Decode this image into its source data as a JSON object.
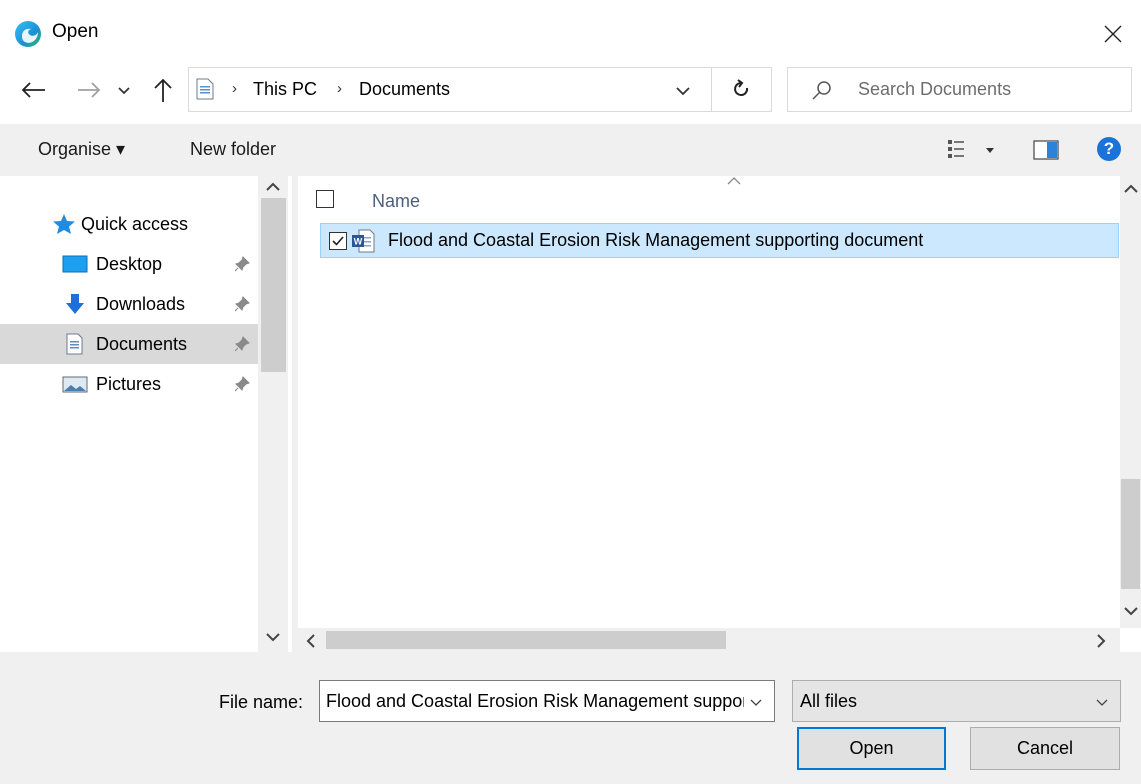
{
  "window": {
    "title": "Open",
    "icons": {
      "app": "edge-icon",
      "close": "close-icon"
    }
  },
  "address": {
    "crumbs": [
      "This PC",
      "Documents"
    ],
    "separator": "›"
  },
  "search": {
    "placeholder": "Search Documents"
  },
  "toolbar": {
    "organise_label": "Organise ▾",
    "new_folder_label": "New folder",
    "help_label": "?"
  },
  "nav": {
    "items": [
      {
        "label": "Quick access",
        "icon": "star-icon"
      },
      {
        "label": "Desktop",
        "icon": "desktop-icon",
        "pinned": true
      },
      {
        "label": "Downloads",
        "icon": "download-arrow-icon",
        "pinned": true
      },
      {
        "label": "Documents",
        "icon": "documents-icon",
        "pinned": true,
        "selected": true
      },
      {
        "label": "Pictures",
        "icon": "pictures-icon",
        "pinned": true
      }
    ]
  },
  "files": {
    "column_name": "Name",
    "rows": [
      {
        "name": "Flood and Coastal Erosion Risk Management supporting document",
        "checked": true,
        "selected": true,
        "icon": "word-doc-icon"
      }
    ]
  },
  "bottom": {
    "file_name_label": "File name:",
    "file_name_value": "Flood and Coastal Erosion Risk Management supporting document",
    "filter_value": "All files",
    "open_label": "Open",
    "cancel_label": "Cancel"
  },
  "colors": {
    "accent": "#0078d7",
    "selection_bg": "#cce8ff",
    "selection_border": "#99d1ff",
    "chrome_bg": "#f0f0f0"
  }
}
